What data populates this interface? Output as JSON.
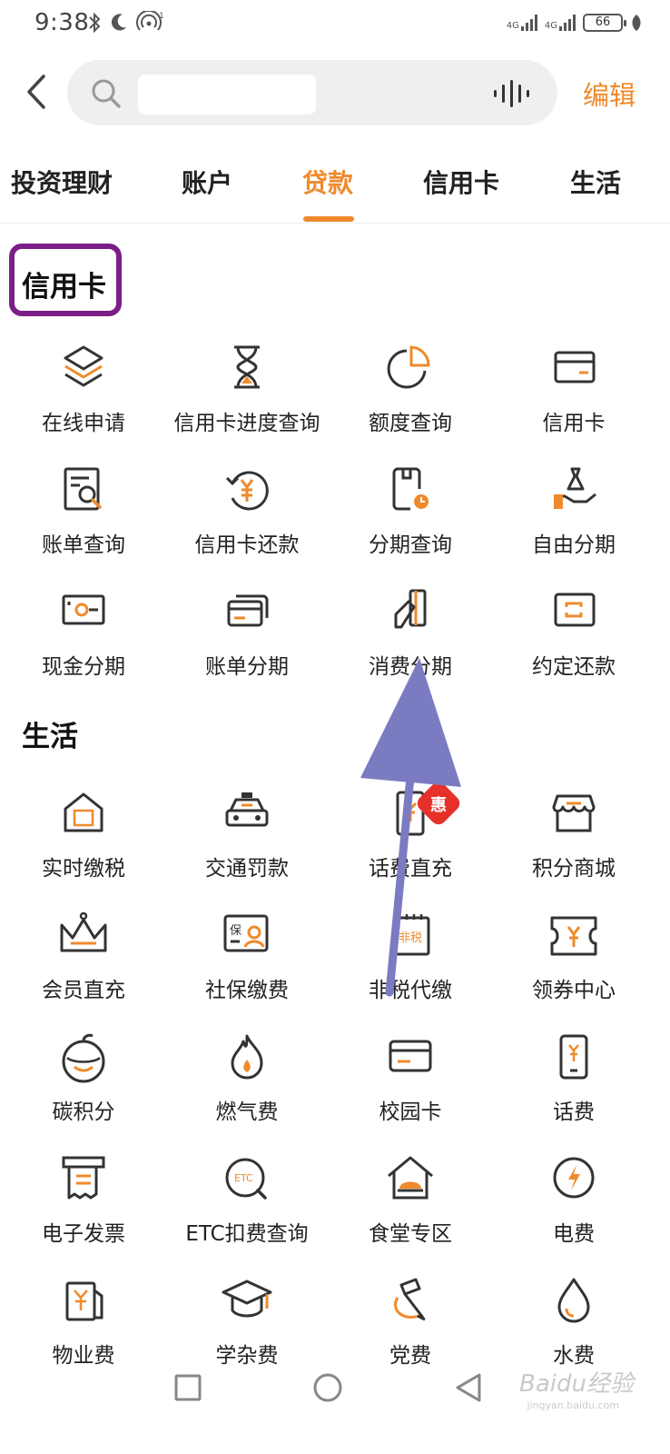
{
  "status": {
    "time": "9:38",
    "battery": "66",
    "signal1": "4G",
    "signal2": "4G"
  },
  "search": {
    "placeholder": "",
    "edit_label": "编辑"
  },
  "tabs": [
    {
      "label": "投资理财"
    },
    {
      "label": "账户"
    },
    {
      "label": "贷款"
    },
    {
      "label": "信用卡"
    },
    {
      "label": "生活"
    }
  ],
  "active_tab": "贷款",
  "credit_section": {
    "title": "信用卡",
    "items": [
      {
        "label": "在线申请",
        "icon": "layers-icon"
      },
      {
        "label": "信用卡进度查询",
        "icon": "hourglass-icon"
      },
      {
        "label": "额度查询",
        "icon": "pie-chart-icon"
      },
      {
        "label": "信用卡",
        "icon": "card-icon"
      },
      {
        "label": "账单查询",
        "icon": "bill-search-icon"
      },
      {
        "label": "信用卡还款",
        "icon": "yuan-refresh-icon"
      },
      {
        "label": "分期查询",
        "icon": "installment-clock-icon"
      },
      {
        "label": "自由分期",
        "icon": "money-bag-hand-icon"
      },
      {
        "label": "现金分期",
        "icon": "cash-icon"
      },
      {
        "label": "账单分期",
        "icon": "bill-cards-icon"
      },
      {
        "label": "消费分期",
        "icon": "pen-card-icon"
      },
      {
        "label": "约定还款",
        "icon": "repeat-card-icon"
      }
    ]
  },
  "life_section": {
    "title": "生活",
    "items": [
      {
        "label": "实时缴税",
        "icon": "tax-house-icon"
      },
      {
        "label": "交通罚款",
        "icon": "taxi-icon"
      },
      {
        "label": "话费直充",
        "icon": "phone-topup-icon"
      },
      {
        "label": "积分商城",
        "icon": "store-icon"
      },
      {
        "label": "会员直充",
        "icon": "crown-icon"
      },
      {
        "label": "社保缴费",
        "icon": "social-security-icon"
      },
      {
        "label": "非税代缴",
        "icon": "non-tax-icon"
      },
      {
        "label": "领券中心",
        "icon": "coupon-icon"
      },
      {
        "label": "碳积分",
        "icon": "carbon-face-icon"
      },
      {
        "label": "燃气费",
        "icon": "flame-icon"
      },
      {
        "label": "校园卡",
        "icon": "campus-card-icon"
      },
      {
        "label": "话费",
        "icon": "mobile-yuan-icon"
      },
      {
        "label": "电子发票",
        "icon": "invoice-icon"
      },
      {
        "label": "ETC扣费查询",
        "icon": "etc-search-icon"
      },
      {
        "label": "食堂专区",
        "icon": "canteen-icon"
      },
      {
        "label": "电费",
        "icon": "lightning-icon"
      },
      {
        "label": "物业费",
        "icon": "property-fee-icon"
      },
      {
        "label": "学杂费",
        "icon": "graduation-cap-icon"
      },
      {
        "label": "党费",
        "icon": "party-emblem-icon"
      },
      {
        "label": "水费",
        "icon": "water-drop-icon"
      }
    ],
    "promo_badge": "惠"
  },
  "watermark": {
    "main": "Baidu经验",
    "sub": "jingyan.baidu.com"
  },
  "colors": {
    "accent": "#ef8a2c",
    "highlight_box": "#7b1f86",
    "arrow": "#7b7bc2",
    "badge": "#e6312b"
  }
}
